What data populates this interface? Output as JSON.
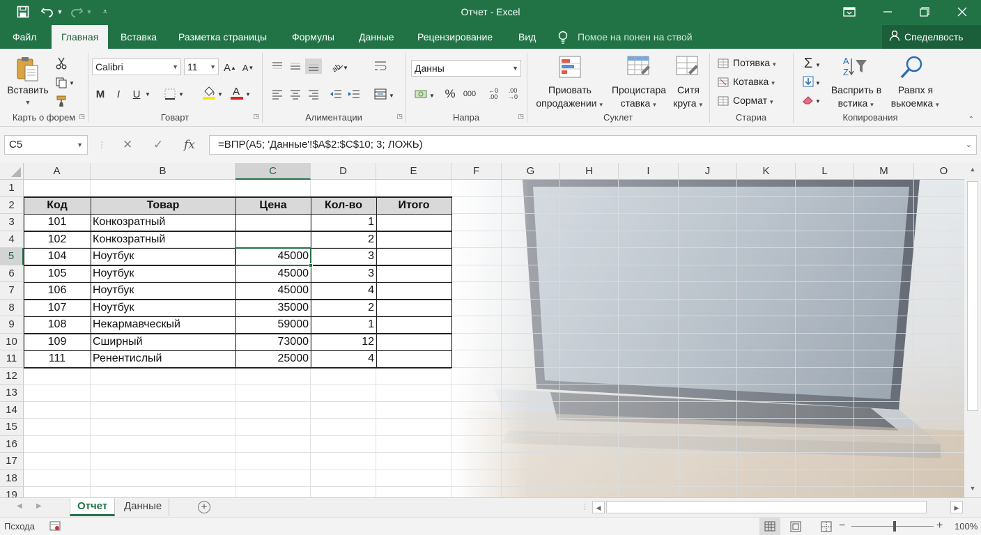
{
  "title_bar": {
    "title": "Отчет  -  Excel"
  },
  "tabs": [
    "Файл",
    "Главная",
    "Вставка",
    "Разметка страницы",
    "Формулы",
    "Данные",
    "Рецензирование",
    "Вид"
  ],
  "active_tab": "Главная",
  "tell_me": "Помое на понен на ствой",
  "share_label": "Спеделвость",
  "ribbon": {
    "clipboard": {
      "paste": "Вставить",
      "label": "Карть о форем"
    },
    "font": {
      "name": "Calibri",
      "size": "11",
      "label": "Говарт",
      "bold": "M",
      "italic": "I",
      "underline": "U"
    },
    "alignment": {
      "label": "Алиментации"
    },
    "number": {
      "format": "Данны",
      "label": "Напра",
      "percent": "%",
      "thousands": "000"
    },
    "styles": {
      "cond_format": [
        "Приовать",
        "опродажении"
      ],
      "format_table": [
        "Процистара",
        "ставка"
      ],
      "cell_styles": [
        "Ситя",
        "круга"
      ],
      "label": "Суклет"
    },
    "cells": {
      "insert": "Потявка",
      "delete": "Котавка",
      "format": "Сормат",
      "label": "Стариа"
    },
    "editing": {
      "sort": [
        "Васприть в",
        "встика"
      ],
      "find": [
        "Равпх я",
        "вькоемка"
      ],
      "label": "Копирования"
    }
  },
  "name_box": "C5",
  "formula": "=ВПР(A5; 'Данные'!$A$2:$C$10; 3; ЛОЖЬ)",
  "columns": [
    "A",
    "B",
    "C",
    "D",
    "E",
    "F",
    "G",
    "H",
    "I",
    "J",
    "K",
    "L",
    "M",
    "O"
  ],
  "rows": [
    "1",
    "2",
    "3",
    "4",
    "5",
    "6",
    "7",
    "8",
    "9",
    "10",
    "11",
    "12",
    "13",
    "14",
    "15",
    "16",
    "17",
    "18",
    "19"
  ],
  "selected_cell": {
    "column": "C",
    "row": "5"
  },
  "table": {
    "headers": [
      "Код",
      "Товар",
      "Цена",
      "Кол-во",
      "Итого"
    ],
    "rows": [
      [
        "101",
        "Конкозратный",
        "",
        "1",
        ""
      ],
      [
        "102",
        "Конкозратный",
        "",
        "2",
        ""
      ],
      [
        "104",
        "Ноутбук",
        "45000",
        "3",
        ""
      ],
      [
        "105",
        "Ноутбук",
        "45000",
        "3",
        ""
      ],
      [
        "106",
        "Ноутбук",
        "45000",
        "4",
        ""
      ],
      [
        "107",
        "Ноутбук",
        "35000",
        "2",
        ""
      ],
      [
        "108",
        "Некармавческый",
        "59000",
        "1",
        ""
      ],
      [
        "109",
        "Сширный",
        "73000",
        "12",
        ""
      ],
      [
        "111",
        "Ренентислый",
        "25000",
        "4",
        ""
      ]
    ]
  },
  "sheets": [
    "Отчет",
    "Данные"
  ],
  "active_sheet": "Отчет",
  "status": {
    "ready": "Псхода",
    "zoom": "100%"
  },
  "colors": {
    "brand": "#217346",
    "ribbon": "#f3f3f3",
    "header_fill": "#d9d9d9"
  }
}
